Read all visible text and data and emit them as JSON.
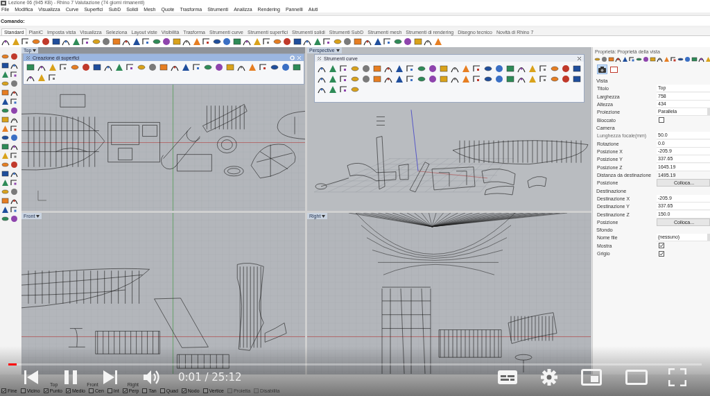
{
  "window": {
    "title": "Lezione 06 (945 KB) - Rhino 7 Valutazione (74 giorni rimanenti)"
  },
  "menu": [
    "File",
    "Modifica",
    "Visualizza",
    "Curve",
    "Superfici",
    "SubD",
    "Solidi",
    "Mesh",
    "Quote",
    "Trasforma",
    "Strumenti",
    "Analizza",
    "Rendering",
    "Pannelli",
    "Aiuti"
  ],
  "command": {
    "label": "Comando:"
  },
  "toolbar_tabs": [
    {
      "label": "Standard",
      "selected": true
    },
    {
      "label": "PianiC",
      "selected": false
    },
    {
      "label": "Imposta vista",
      "selected": false
    },
    {
      "label": "Visualizza",
      "selected": false
    },
    {
      "label": "Seleziona",
      "selected": false
    },
    {
      "label": "Layout viste",
      "selected": false
    },
    {
      "label": "Visibilità",
      "selected": false
    },
    {
      "label": "Trasforma",
      "selected": false
    },
    {
      "label": "Strumenti curve",
      "selected": false
    },
    {
      "label": "Strumenti superfici",
      "selected": false
    },
    {
      "label": "Strumenti solidi",
      "selected": false
    },
    {
      "label": "Strumenti SubD",
      "selected": false
    },
    {
      "label": "Strumenti mesh",
      "selected": false
    },
    {
      "label": "Strumenti di rendering",
      "selected": false
    },
    {
      "label": "Disegno tecnico",
      "selected": false
    },
    {
      "label": "Novità di Rhino 7",
      "selected": false
    }
  ],
  "viewports": [
    {
      "title": "Top",
      "kind": "top"
    },
    {
      "title": "Perspective",
      "kind": "perspective"
    },
    {
      "title": "Front",
      "kind": "front"
    },
    {
      "title": "Right",
      "kind": "right"
    }
  ],
  "floating_toolbars": [
    {
      "title": "Creazione di superfici"
    },
    {
      "title": "Strumenti curve"
    }
  ],
  "properties": {
    "title": "Proprietà: Proprietà della vista",
    "sections": [
      {
        "title": "Vista",
        "rows": [
          {
            "label": "Titolo",
            "kind": "text",
            "value": "Top",
            "disabled": false
          },
          {
            "label": "Larghezza",
            "kind": "text",
            "value": "758",
            "disabled": false
          },
          {
            "label": "Altezza",
            "kind": "text",
            "value": "434",
            "disabled": false
          },
          {
            "label": "Proiezione",
            "kind": "dropdown",
            "value": "Parallela",
            "disabled": false
          },
          {
            "label": "Bloccato",
            "kind": "check",
            "checked": false,
            "disabled": false
          }
        ]
      },
      {
        "title": "Camera",
        "rows": [
          {
            "label": "Lunghezza focale(mm)",
            "kind": "text",
            "value": "50.0",
            "disabled": true
          },
          {
            "label": "Rotazione",
            "kind": "text",
            "value": "0.0",
            "disabled": false
          },
          {
            "label": "Posizione X",
            "kind": "text",
            "value": "-205.9",
            "disabled": false
          },
          {
            "label": "Posizione Y",
            "kind": "text",
            "value": "337.65",
            "disabled": false
          },
          {
            "label": "Posizione Z",
            "kind": "text",
            "value": "1645.19",
            "disabled": false
          },
          {
            "label": "Distanza da destinazione",
            "kind": "readout",
            "value": "1495.19",
            "disabled": false
          },
          {
            "label": "Posizione",
            "kind": "button",
            "value": "Colloca...",
            "disabled": false
          }
        ]
      },
      {
        "title": "Destinazione",
        "rows": [
          {
            "label": "Destinazione X",
            "kind": "text",
            "value": "-205.9",
            "disabled": false
          },
          {
            "label": "Destinazione Y",
            "kind": "text",
            "value": "337.65",
            "disabled": false
          },
          {
            "label": "Destinazione Z",
            "kind": "text",
            "value": "150.0",
            "disabled": false
          },
          {
            "label": "Posizione",
            "kind": "button",
            "value": "Colloca...",
            "disabled": false
          }
        ]
      },
      {
        "title": "Sfondo",
        "rows": [
          {
            "label": "Nome file",
            "kind": "dropdown",
            "value": "(nessuno)",
            "disabled": false
          },
          {
            "label": "Mostra",
            "kind": "check",
            "checked": true,
            "disabled": false
          },
          {
            "label": "Grigio",
            "kind": "check",
            "checked": true,
            "disabled": false
          }
        ]
      }
    ]
  },
  "status": {
    "viewport_tabs": [
      "Top",
      "Front",
      "Right"
    ],
    "osnaps": [
      {
        "label": "Fine",
        "checked": true,
        "disabled": false
      },
      {
        "label": "Vicino",
        "checked": false,
        "disabled": false
      },
      {
        "label": "Punto",
        "checked": true,
        "disabled": false
      },
      {
        "label": "Medio",
        "checked": true,
        "disabled": false
      },
      {
        "label": "Cen",
        "checked": false,
        "disabled": false
      },
      {
        "label": "Int",
        "checked": false,
        "disabled": false
      },
      {
        "label": "Perp",
        "checked": true,
        "disabled": false
      },
      {
        "label": "Tan",
        "checked": false,
        "disabled": false
      },
      {
        "label": "Quad",
        "checked": false,
        "disabled": false
      },
      {
        "label": "Nodo",
        "checked": true,
        "disabled": false
      },
      {
        "label": "Vertice",
        "checked": false,
        "disabled": false
      },
      {
        "label": "Proietta",
        "checked": false,
        "disabled": true
      },
      {
        "label": "Disabilita",
        "checked": false,
        "disabled": true
      }
    ]
  },
  "player": {
    "time": "0:01 / 25:12",
    "playing": true,
    "progress": {
      "level": 0.012
    }
  }
}
